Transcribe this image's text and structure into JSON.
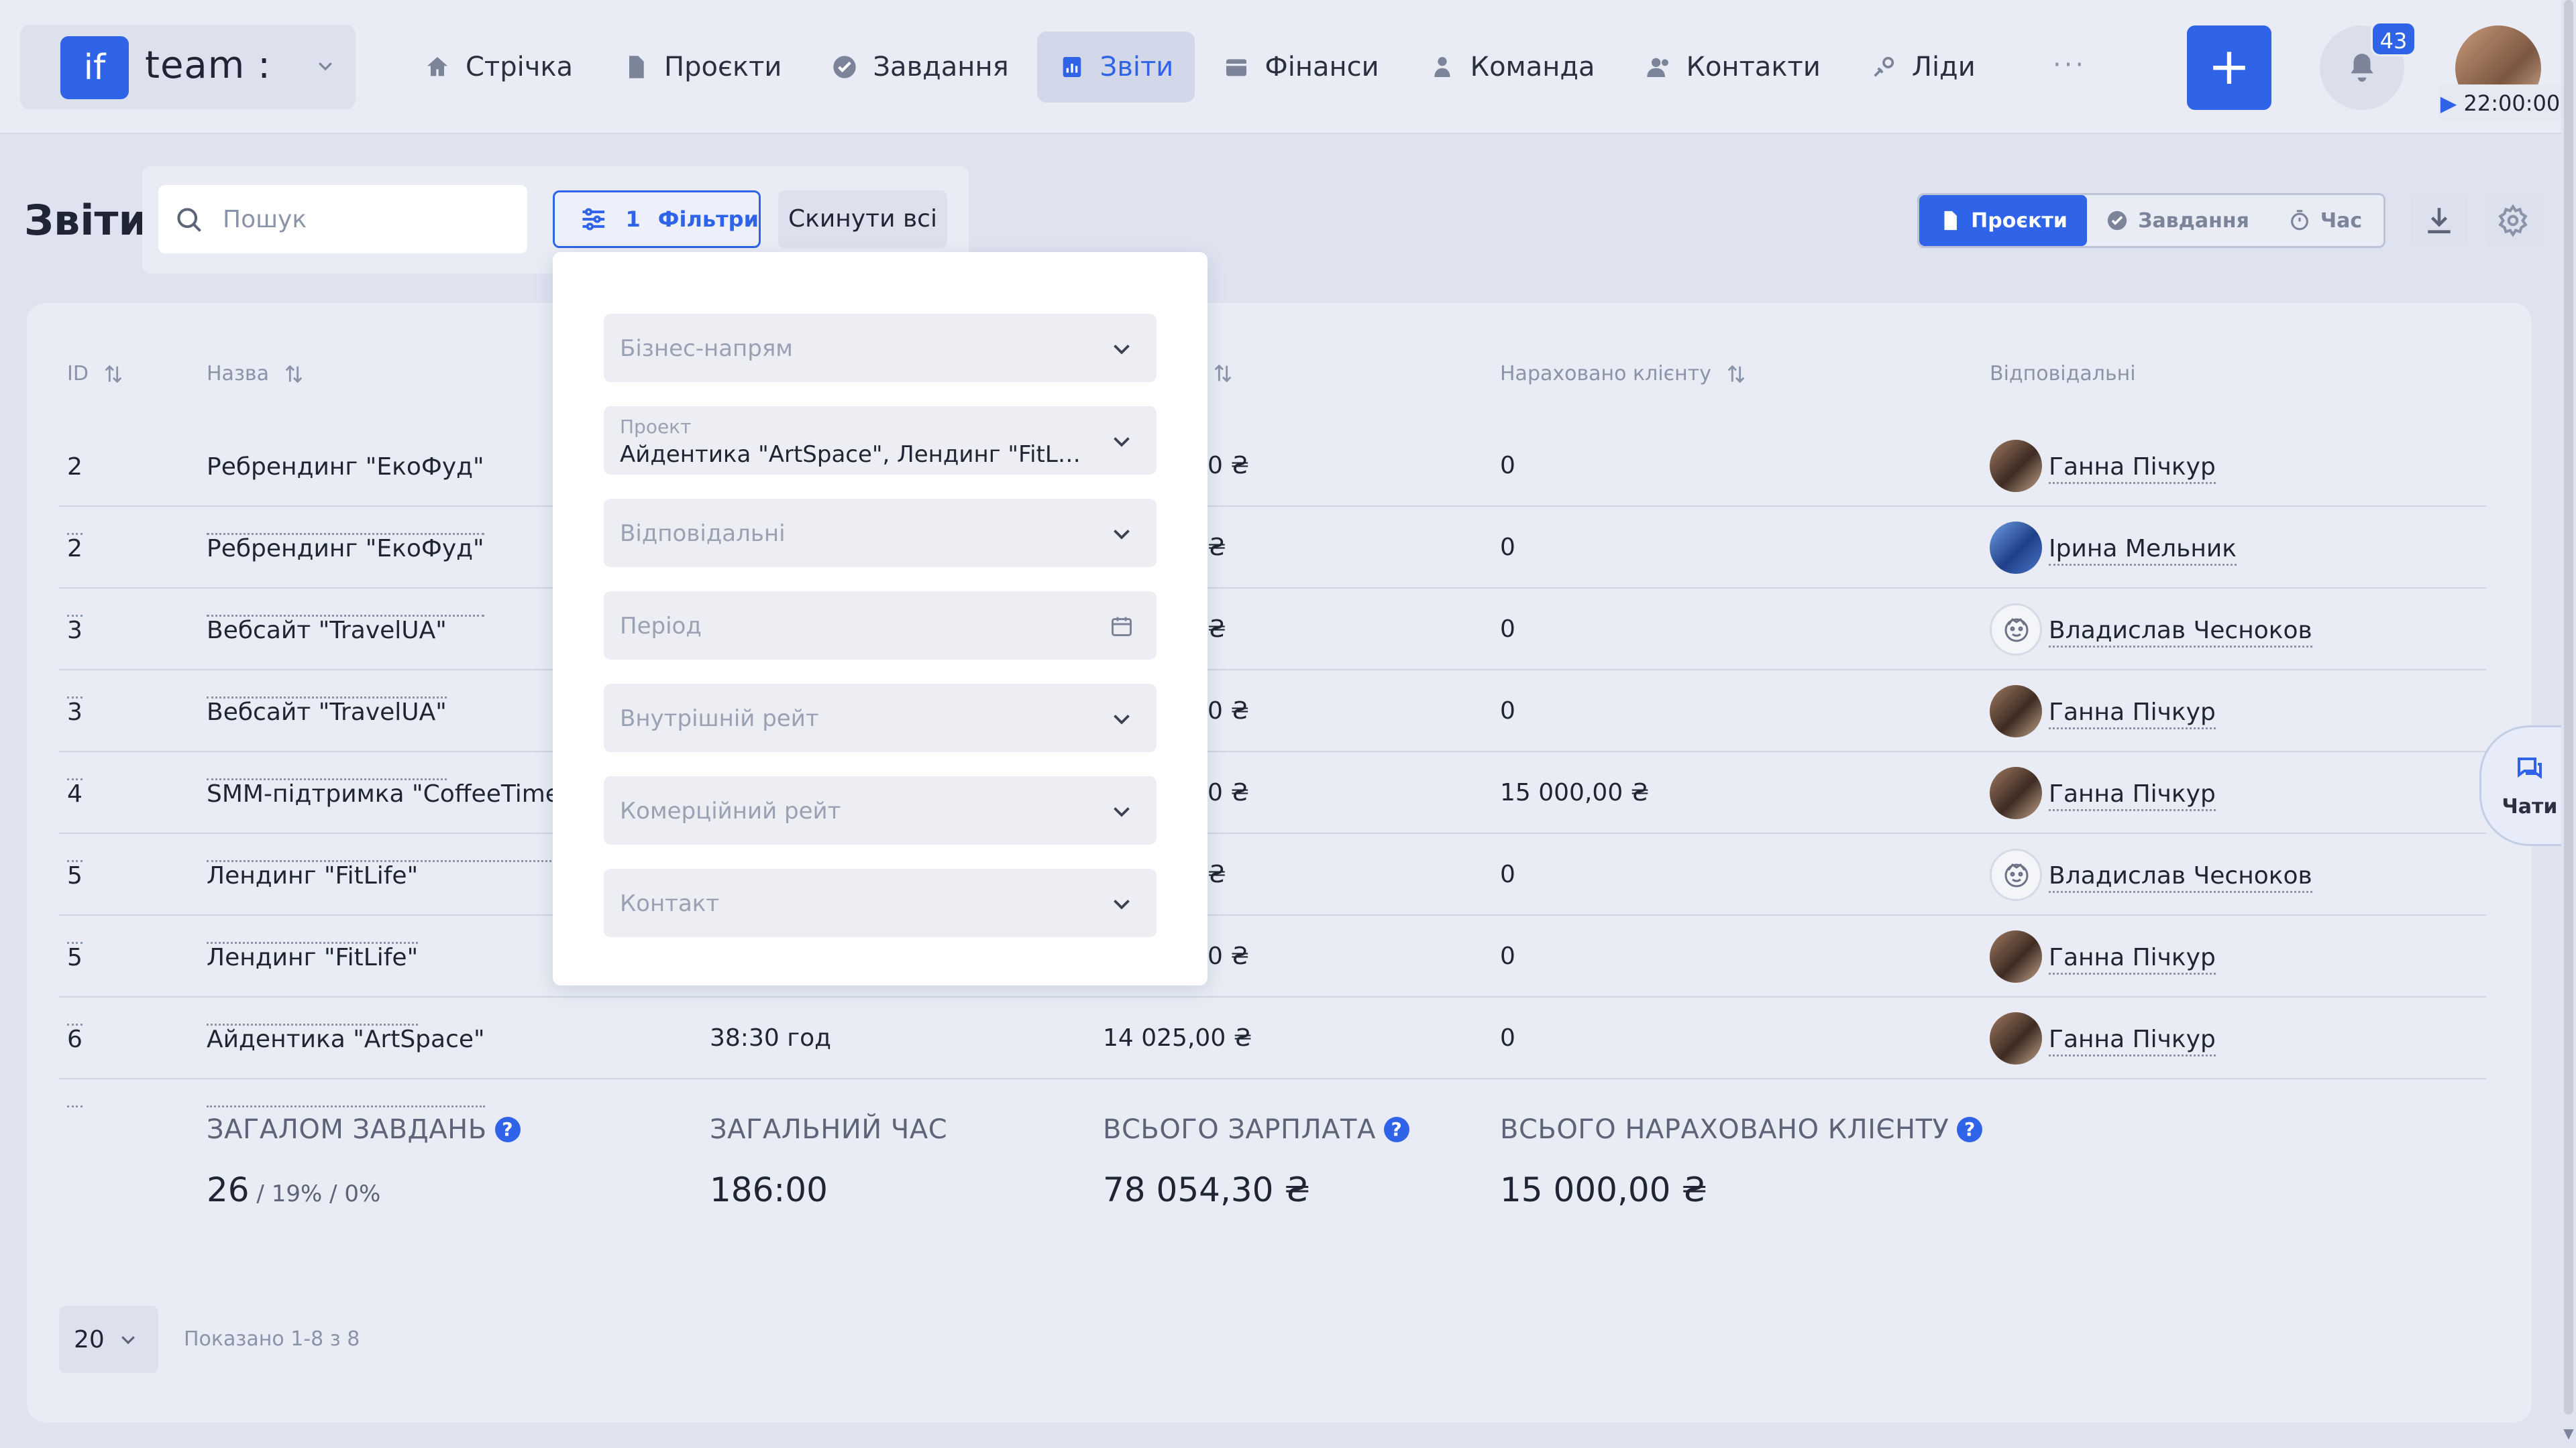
{
  "brand": {
    "logo": "if",
    "name": "team :"
  },
  "nav": [
    {
      "label": "Стрічка",
      "icon": "home-icon"
    },
    {
      "label": "Проєкти",
      "icon": "document-icon"
    },
    {
      "label": "Завдання",
      "icon": "check-circle-icon"
    },
    {
      "label": "Звіти",
      "icon": "report-icon",
      "active": true
    },
    {
      "label": "Фінанси",
      "icon": "wallet-icon"
    },
    {
      "label": "Команда",
      "icon": "person-icon"
    },
    {
      "label": "Контакти",
      "icon": "contacts-icon"
    },
    {
      "label": "Ліди",
      "icon": "leads-icon"
    }
  ],
  "topbar": {
    "more": "···",
    "add": "+",
    "notifications": "43",
    "timer": "22:00:00"
  },
  "page": {
    "title": "Звіти",
    "search_placeholder": "Пошук",
    "filters_count": "1",
    "filters_label": "Фільтри",
    "reset_label": "Скинути всі",
    "views": [
      "Проєкти",
      "Завдання",
      "Час"
    ]
  },
  "filters": {
    "business": "Бізнес-напрям",
    "project_label": "Проект",
    "project_value": "Айдентика \"ArtSpace\", Лендинг \"FitLife\"",
    "responsible": "Відповідальні",
    "period": "Період",
    "internal_rate": "Внутрішній рейт",
    "commercial_rate": "Комерційний рейт",
    "contact": "Контакт"
  },
  "table": {
    "headers": {
      "id": "ID",
      "name": "Назва",
      "billed": "Нараховано клієнту",
      "responsible": "Відповідальні"
    },
    "rows": [
      {
        "id": "2",
        "name": "Ребрендинг \"ЕкоФуд\"",
        "salary_tail": "0 ₴",
        "billed": "0",
        "responsible": "Ганна Пічкур",
        "avatar": "photo"
      },
      {
        "id": "2",
        "name": "Ребрендинг \"ЕкоФуд\"",
        "salary_tail": "₴",
        "billed": "0",
        "responsible": "Ірина Мельник",
        "avatar": "blue"
      },
      {
        "id": "3",
        "name": "Вебсайт \"TravelUA\"",
        "salary_tail": "₴",
        "billed": "0",
        "responsible": "Владислав Чесноков",
        "avatar": "sketch"
      },
      {
        "id": "3",
        "name": "Вебсайт \"TravelUA\"",
        "salary_tail": "0 ₴",
        "billed": "0",
        "responsible": "Ганна Пічкур",
        "avatar": "photo"
      },
      {
        "id": "4",
        "name": "SMM-підтримка \"CoffeeTime\"",
        "salary_tail": "0 ₴",
        "billed": "15 000,00 ₴",
        "responsible": "Ганна Пічкур",
        "avatar": "photo"
      },
      {
        "id": "5",
        "name": "Лендинг \"FitLife\"",
        "salary_tail": "₴",
        "billed": "0",
        "responsible": "Владислав Чесноков",
        "avatar": "sketch"
      },
      {
        "id": "5",
        "name": "Лендинг \"FitLife\"",
        "salary_tail": "0 ₴",
        "billed": "0",
        "responsible": "Ганна Пічкур",
        "avatar": "photo"
      },
      {
        "id": "6",
        "name": "Айдентика \"ArtSpace\"",
        "time": "38:30 год",
        "salary": "14 025,00 ₴",
        "billed": "0",
        "responsible": "Ганна Пічкур",
        "avatar": "photo"
      }
    ]
  },
  "totals": {
    "tasks_label": "ЗАГАЛОМ ЗАВДАНЬ",
    "tasks_value": "26",
    "tasks_sub": " / 19% / 0%",
    "time_label": "ЗАГАЛЬНИЙ ЧАС",
    "time_value": "186:00",
    "salary_label": "ВСЬОГО ЗАРПЛАТА",
    "salary_value": "78 054,30 ₴",
    "billed_label": "ВСЬОГО НАРАХОВАНО КЛІЄНТУ",
    "billed_value": "15 000,00 ₴"
  },
  "pagination": {
    "per_page": "20",
    "showing": "Показано 1-8 з 8"
  },
  "chat": {
    "label": "Чати"
  },
  "colors": {
    "accent": "#2f64e8",
    "background": "#dfe3f0",
    "card": "#e9ecf5"
  }
}
